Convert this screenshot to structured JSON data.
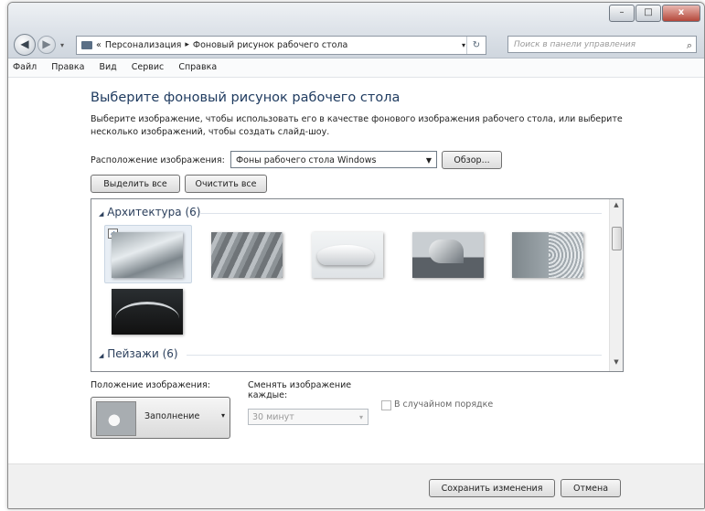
{
  "window": {
    "buttons": {
      "minimize": "–",
      "maximize": "□",
      "close": "x"
    }
  },
  "nav": {
    "back_icon": "back-arrow-icon",
    "forward_icon": "forward-arrow-icon",
    "back_glyph": "◀",
    "forward_glyph": "▶",
    "dropdown_glyph": "▾"
  },
  "address": {
    "prefix": "«",
    "crumb1": "Персонализация",
    "sep": "▸",
    "crumb2": "Фоновый рисунок рабочего стола",
    "dropdown_glyph": "▾",
    "refresh_glyph": "↻"
  },
  "search": {
    "placeholder": "Поиск в панели управления",
    "icon_glyph": "⌕"
  },
  "menu": [
    "Файл",
    "Правка",
    "Вид",
    "Сервис",
    "Справка"
  ],
  "main": {
    "title": "Выберите фоновый рисунок рабочего стола",
    "desc_line1": "Выберите изображение, чтобы использовать его в качестве фонового изображения рабочего стола, или выберите",
    "desc_line2": "несколько изображений, чтобы создать слайд-шоу.",
    "location_label": "Расположение изображения:",
    "location_value": "Фоны рабочего стола Windows",
    "browse_button": "Обзор...",
    "select_all_button": "Выделить все",
    "clear_all_button": "Очистить все"
  },
  "gallery": {
    "groups": [
      {
        "label": "Архитектура (6)",
        "collapse_glyph": "◢"
      },
      {
        "label": "Пейзажи (6)",
        "collapse_glyph": "◢"
      }
    ],
    "checkmark": "✓",
    "scroll_up": "▲",
    "scroll_down": "▼"
  },
  "options": {
    "position_label": "Положение изображения:",
    "position_value": "Заполнение",
    "interval_label_line1": "Сменять изображение",
    "interval_label_line2": "каждые:",
    "interval_value": "30 минут",
    "shuffle_label": "В случайном порядке",
    "dropdown_glyph": "▾"
  },
  "footer": {
    "save_button": "Сохранить изменения",
    "cancel_button": "Отмена"
  },
  "colors": {
    "title_blue": "#1e3a5f",
    "close_red": "#b4473a"
  }
}
